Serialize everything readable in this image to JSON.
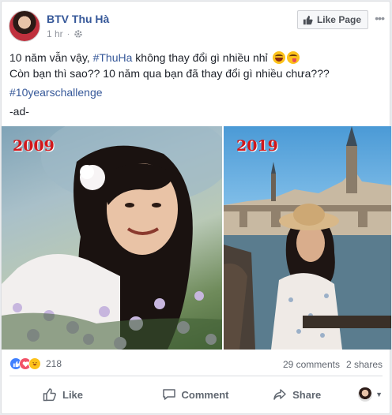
{
  "post": {
    "page_name": "BTV Thu Hà",
    "time": "1 hr",
    "meta_sep": "·",
    "like_page_label": "Like Page",
    "more_label": "•••",
    "text": {
      "line1_prefix": "10 năm vẫn vậy, ",
      "line1_hashtag": "#ThuHa",
      "line1_suffix": " không thay đổi gì nhiều nhỉ ",
      "line2": "Còn bạn thì sao?? 10 năm qua bạn đã thay đổi gì nhiều chưa???",
      "hashtag": "#10yearschallenge",
      "signoff": "-ad-"
    },
    "photos": [
      {
        "year": "2009"
      },
      {
        "year": "2019"
      }
    ]
  },
  "stats": {
    "reaction_count": "218",
    "comments": "29 comments",
    "shares": "2 shares"
  },
  "actions": {
    "like_label": "Like",
    "comment_label": "Comment",
    "share_label": "Share"
  },
  "colors": {
    "link_blue": "#365899",
    "year_red": "#d2171b",
    "like_blue": "#4080ff",
    "love_red": "#f25268",
    "haha_yellow": "#fcc21b"
  }
}
